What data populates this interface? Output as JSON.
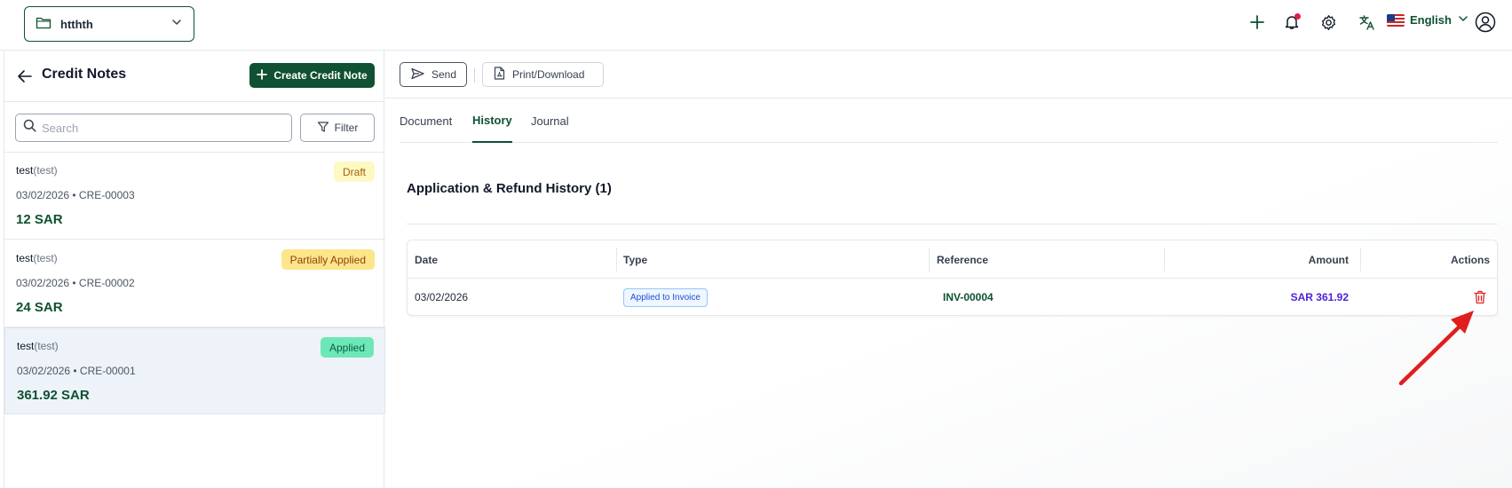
{
  "topbar": {
    "org_name": "htthth",
    "language": "English",
    "icons": [
      "folder-icon",
      "chevron-down-icon",
      "plus-icon",
      "bell-icon",
      "gear-icon",
      "translate-icon",
      "us-flag-icon",
      "user-circle-icon"
    ]
  },
  "left_panel": {
    "title": "Credit Notes",
    "create_label": "Create Credit Note",
    "search_placeholder": "Search",
    "filter_label": "Filter",
    "notes": [
      {
        "customer": "test",
        "alias": "(test)",
        "date": "03/02/2026",
        "number": "CRE-00003",
        "meta": "03/02/2026 • CRE-00003",
        "amount": "12 SAR",
        "status": "Draft"
      },
      {
        "customer": "test",
        "alias": "(test)",
        "date": "03/02/2026",
        "number": "CRE-00002",
        "meta": "03/02/2026 • CRE-00002",
        "amount": "24 SAR",
        "status": "Partially Applied"
      },
      {
        "customer": "test",
        "alias": "(test)",
        "date": "03/02/2026",
        "number": "CRE-00001",
        "meta": "03/02/2026 • CRE-00001",
        "amount": "361.92 SAR",
        "status": "Applied"
      }
    ]
  },
  "toolbar": {
    "send_label": "Send",
    "print_label": "Print/Download"
  },
  "tabs": [
    {
      "label": "Document",
      "active": false
    },
    {
      "label": "History",
      "active": true
    },
    {
      "label": "Journal",
      "active": false
    }
  ],
  "history": {
    "title": "Application & Refund History (1)",
    "columns": [
      "Date",
      "Type",
      "Reference",
      "Amount",
      "Actions"
    ],
    "rows": [
      {
        "date": "03/02/2026",
        "type": "Applied to Invoice",
        "reference": "INV-00004",
        "amount": "SAR 361.92"
      }
    ]
  },
  "colors": {
    "brand": "#0f5132",
    "amount": "#4f23d6",
    "delete": "#dc2626",
    "annotation_arrow": "#e11d1d"
  }
}
